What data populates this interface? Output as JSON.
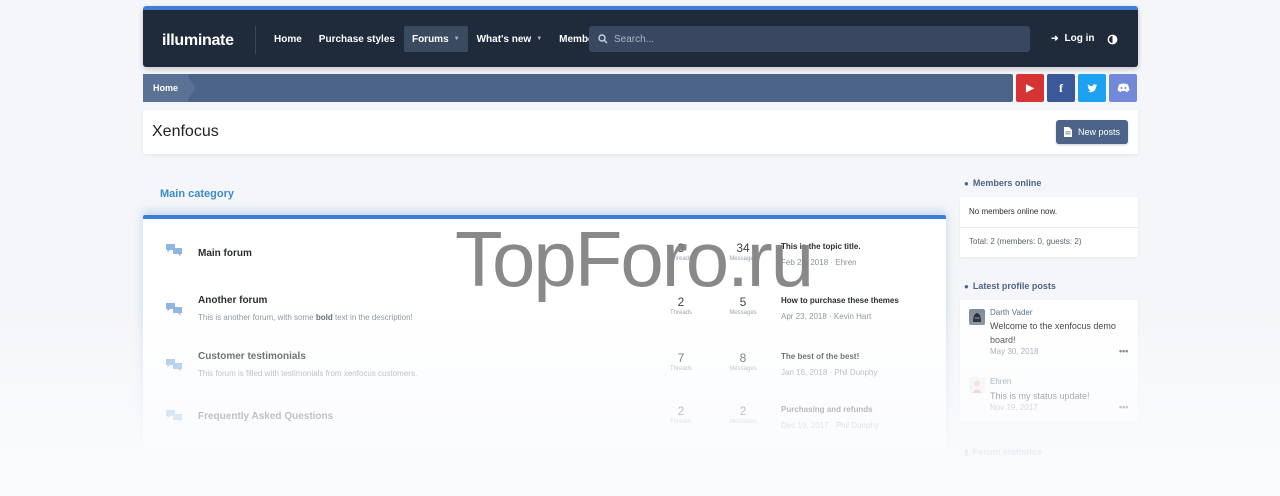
{
  "header": {
    "logo": "illuminate",
    "nav": [
      {
        "label": "Home",
        "caret": false,
        "active": false
      },
      {
        "label": "Purchase styles",
        "caret": false,
        "active": false
      },
      {
        "label": "Forums",
        "caret": true,
        "active": true
      },
      {
        "label": "What's new",
        "caret": true,
        "active": false
      },
      {
        "label": "Members",
        "caret": true,
        "active": false
      }
    ],
    "search_placeholder": "Search...",
    "login_label": "Log in"
  },
  "breadcrumb": {
    "home": "Home"
  },
  "social": [
    {
      "name": "youtube",
      "glyph": "▶",
      "color": "#d63434"
    },
    {
      "name": "facebook",
      "glyph": "f",
      "color": "#3b5998"
    },
    {
      "name": "twitter",
      "glyph": "t",
      "color": "#1da1f2"
    },
    {
      "name": "discord",
      "glyph": "◉",
      "color": "#7289da"
    }
  ],
  "page": {
    "title": "Xenfocus",
    "new_posts_label": "New posts"
  },
  "category": {
    "title": "Main category",
    "forums": [
      {
        "name": "Main forum",
        "description": "",
        "threads": "3",
        "messages": "34",
        "threads_label": "Threads",
        "messages_label": "Messages",
        "latest_title": "This is the topic title.",
        "latest_meta": "Feb 28, 2018 · Ehren"
      },
      {
        "name": "Another forum",
        "description_pre": "This is another forum, with some ",
        "description_bold": "bold",
        "description_post": " text in the description!",
        "threads": "2",
        "messages": "5",
        "threads_label": "Threads",
        "messages_label": "Messages",
        "latest_title": "How to purchase these themes",
        "latest_meta": "Apr 23, 2018 · Kevin Hart"
      },
      {
        "name": "Customer testimonials",
        "description": "This forum is filled with testimonials from xenfocus customers.",
        "threads": "7",
        "messages": "8",
        "threads_label": "Threads",
        "messages_label": "Messages",
        "latest_title": "The best of the best!",
        "latest_meta": "Jan 16, 2018 · Phil Dunphy"
      },
      {
        "name": "Frequently Asked Questions",
        "description": "",
        "threads": "2",
        "messages": "2",
        "threads_label": "Threads",
        "messages_label": "Messages",
        "latest_title": "Purchasing and refunds",
        "latest_meta": "Dec 19, 2017 · Phil Dunphy"
      }
    ]
  },
  "sidebar": {
    "members_online": {
      "title": "Members online",
      "text": "No members online now.",
      "total": "Total: 2 (members: 0, guests: 2)"
    },
    "profile_posts": {
      "title": "Latest profile posts",
      "posts": [
        {
          "user": "Darth Vader",
          "body": "Welcome to the xenfocus demo board!",
          "date": "May 30, 2018",
          "more": "•••"
        },
        {
          "user": "Ehren",
          "body": "This is my status update!",
          "date": "Nov 19, 2017",
          "more": "•••"
        }
      ]
    },
    "forum_statistics": {
      "title": "Forum statistics"
    }
  },
  "watermark": "TopForo.ru",
  "colors": {
    "accent": "#3d7fd6",
    "header_bg": "#1f2a3a",
    "breadcrumb_bg": "#4c6488",
    "link": "#3a8bd0"
  }
}
